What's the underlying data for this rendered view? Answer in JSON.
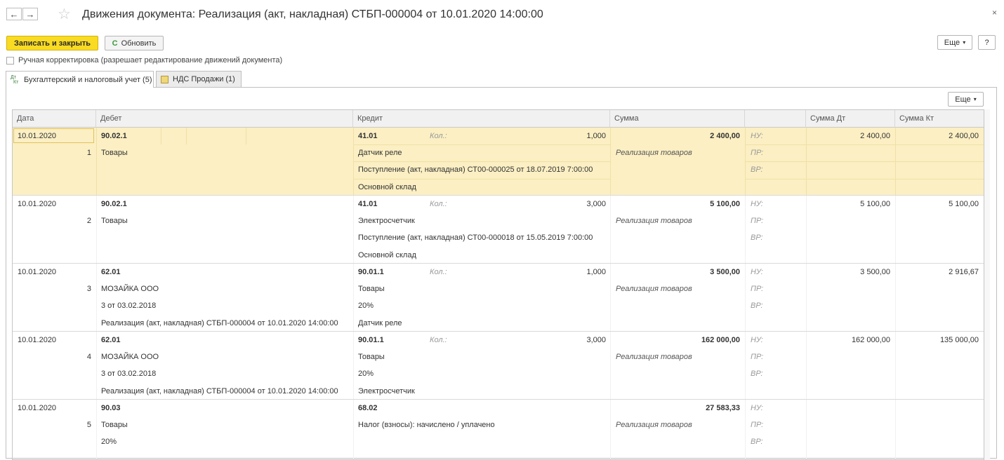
{
  "window": {
    "title": "Движения документа: Реализация (акт, накладная) СТБП-000004 от 10.01.2020 14:00:00",
    "back_glyph": "←",
    "forward_glyph": "→",
    "star_glyph": "☆",
    "close_glyph": "×"
  },
  "toolbar": {
    "save_close_label": "Записать и закрыть",
    "refresh_label": "Обновить",
    "refresh_glyph": "C",
    "more_label": "Еще",
    "more_arrow": "▾",
    "help_label": "?"
  },
  "manual_correction": {
    "label": "Ручная корректировка (разрешает редактирование движений документа)",
    "checked": false
  },
  "tabs": [
    {
      "label": "Бухгалтерский и налоговый учет (5)",
      "icon": "dt-kt-icon",
      "icon_text_top": "Дт",
      "icon_text_bottom": "Кт",
      "active": true
    },
    {
      "label": "НДС Продажи (1)",
      "icon": "register-icon",
      "active": false
    }
  ],
  "table_more": {
    "label": "Еще",
    "arrow": "▾"
  },
  "columns": [
    "Дата",
    "Дебет",
    "Кредит",
    "Сумма",
    "",
    "Сумма Дт",
    "Сумма Кт"
  ],
  "qty_label": "Кол.:",
  "type_labels": [
    "НУ:",
    "ПР:",
    "ВР:"
  ],
  "entries": [
    {
      "date": "10.01.2020",
      "num": "1",
      "debit": [
        "90.02.1",
        "Товары",
        "",
        ""
      ],
      "credit": [
        "41.01",
        "Датчик реле",
        "Поступление (акт, накладная) СТ00-000025 от 18.07.2019 7:00:00",
        "Основной склад"
      ],
      "qty": "1,000",
      "sum": "2 400,00",
      "content": "Реализация товаров",
      "sum_dt": "2 400,00",
      "sum_kt": "2 400,00",
      "selected": true
    },
    {
      "date": "10.01.2020",
      "num": "2",
      "debit": [
        "90.02.1",
        "Товары",
        "",
        ""
      ],
      "credit": [
        "41.01",
        "Электросчетчик",
        "Поступление (акт, накладная) СТ00-000018 от 15.05.2019 7:00:00",
        "Основной склад"
      ],
      "qty": "3,000",
      "sum": "5 100,00",
      "content": "Реализация товаров",
      "sum_dt": "5 100,00",
      "sum_kt": "5 100,00",
      "selected": false
    },
    {
      "date": "10.01.2020",
      "num": "3",
      "debit": [
        "62.01",
        "МОЗАЙКА ООО",
        "3 от 03.02.2018",
        "Реализация (акт, накладная) СТБП-000004 от 10.01.2020 14:00:00"
      ],
      "credit": [
        "90.01.1",
        "Товары",
        "20%",
        "Датчик реле"
      ],
      "qty": "1,000",
      "sum": "3 500,00",
      "content": "Реализация товаров",
      "sum_dt": "3 500,00",
      "sum_kt": "2 916,67",
      "selected": false
    },
    {
      "date": "10.01.2020",
      "num": "4",
      "debit": [
        "62.01",
        "МОЗАЙКА ООО",
        "3 от 03.02.2018",
        "Реализация (акт, накладная) СТБП-000004 от 10.01.2020 14:00:00"
      ],
      "credit": [
        "90.01.1",
        "Товары",
        "20%",
        "Электросчетчик"
      ],
      "qty": "3,000",
      "sum": "162 000,00",
      "content": "Реализация товаров",
      "sum_dt": "162 000,00",
      "sum_kt": "135 000,00",
      "selected": false
    },
    {
      "date": "10.01.2020",
      "num": "5",
      "debit": [
        "90.03",
        "Товары",
        "20%",
        ""
      ],
      "credit": [
        "68.02",
        "Налог (взносы): начислено / уплачено",
        "",
        ""
      ],
      "qty": "",
      "sum": "27 583,33",
      "content": "Реализация товаров",
      "sum_dt": "",
      "sum_kt": "",
      "selected": false
    }
  ]
}
